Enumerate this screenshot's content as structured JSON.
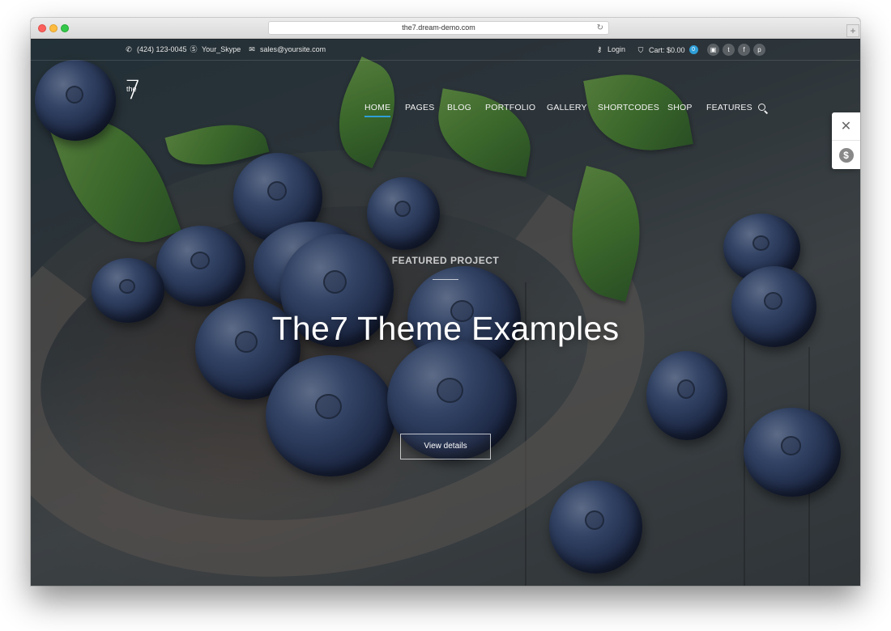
{
  "browser": {
    "url": "the7.dream-demo.com"
  },
  "topbar": {
    "phone": "(424) 123-0045",
    "skype": "Your_Skype",
    "email": "sales@yoursite.com",
    "login": "Login",
    "cart": "Cart: $0.00",
    "cart_count": "0",
    "social": [
      "instagram-icon",
      "twitter-icon",
      "facebook-icon",
      "pinterest-icon"
    ]
  },
  "logo": {
    "mark": "7",
    "word": "the"
  },
  "nav": {
    "items": [
      "HOME",
      "PAGES",
      "BLOG",
      "PORTFOLIO",
      "GALLERY",
      "SHORTCODES",
      "SHOP",
      "FEATURES"
    ],
    "active": "HOME"
  },
  "hero": {
    "kicker": "FEATURED PROJECT",
    "title": "The7 Theme Examples",
    "cta": "View details"
  },
  "colors": {
    "accent": "#2f9fd8"
  }
}
